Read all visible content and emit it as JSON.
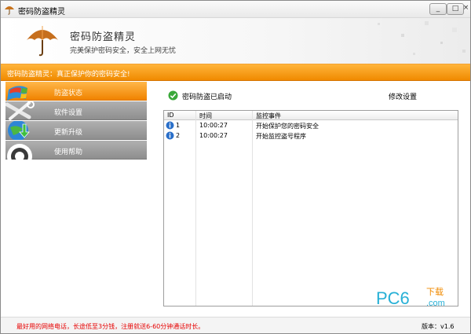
{
  "window": {
    "title": "密码防盗精灵",
    "min_label": "_",
    "max_label": "□",
    "close_label": "×"
  },
  "banner": {
    "name": "密码防盗精灵",
    "slogan": "完美保护密码安全，安全上网无忧"
  },
  "notice": "密码防盗精灵：真正保护你的密码安全!",
  "sidebar": {
    "items": [
      {
        "label": "防盗状态",
        "icon": "windows-logo-icon",
        "active": true
      },
      {
        "label": "软件设置",
        "icon": "tools-icon",
        "active": false
      },
      {
        "label": "更新升级",
        "icon": "update-globe-icon",
        "active": false
      },
      {
        "label": "使用帮助",
        "icon": "help-icon",
        "active": false
      }
    ]
  },
  "status": {
    "text": "密码防盗已启动",
    "settings_label": "修改设置"
  },
  "table": {
    "columns": [
      "ID",
      "时间",
      "监控事件"
    ],
    "rows": [
      {
        "id": "1",
        "time": "10:00:27",
        "event": "开始保护您的密码安全"
      },
      {
        "id": "2",
        "time": "10:00:27",
        "event": "开始监控盗号程序"
      }
    ]
  },
  "watermark": {
    "brand": "PC6",
    "tag": "下载",
    "site": ".com"
  },
  "footer": {
    "promo": "最好用的网络电话，长途低至3分钱，注册就送6-60分钟通话时长。",
    "version": "版本：v1.6"
  },
  "colors": {
    "accent": "#f08a00",
    "sidebar_gray": "#9e9e9e",
    "promo_red": "#e60000",
    "status_green": "#3aa83a",
    "info_blue": "#2a6fc9"
  }
}
